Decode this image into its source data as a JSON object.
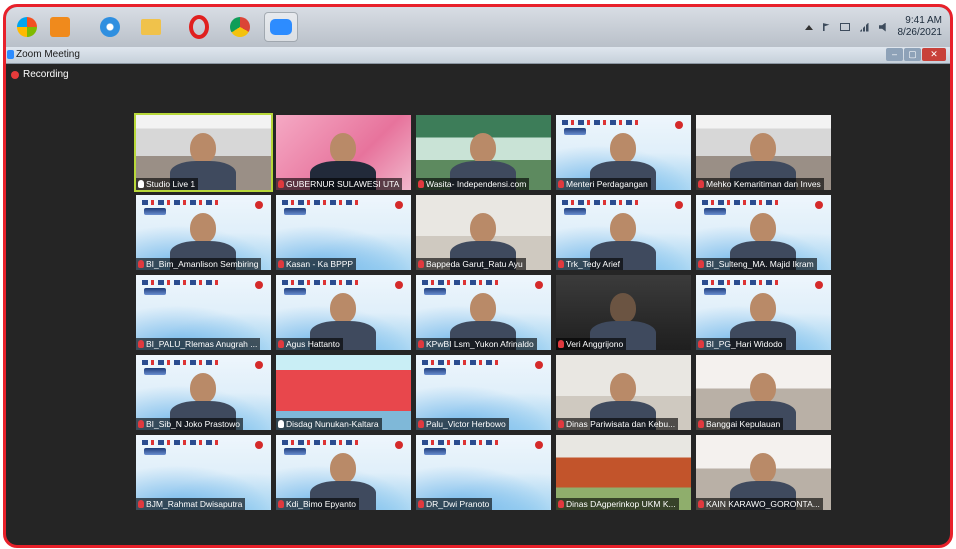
{
  "taskbar": {
    "icons": [
      {
        "name": "windows-start-icon",
        "color": "#1a73d9"
      },
      {
        "name": "media-player-icon",
        "color": "#f08a1c"
      },
      {
        "name": "internet-explorer-icon",
        "color": "#2f8fe0"
      },
      {
        "name": "file-explorer-icon",
        "color": "#f0c24b"
      },
      {
        "name": "opera-browser-icon",
        "color": "#e0201f"
      },
      {
        "name": "chrome-browser-icon",
        "color": "#2da84f"
      },
      {
        "name": "zoom-app-icon",
        "color": "#2d8cff"
      }
    ],
    "clock_time": "9:41 AM",
    "clock_date": "8/26/2021"
  },
  "window": {
    "title": "Zoom Meeting",
    "recording_label": "Recording",
    "accent": "#e8202a"
  },
  "participants": [
    {
      "name": "Studio Live 1",
      "scene": "studio",
      "muted": false,
      "active_speaker": true
    },
    {
      "name": "GUBERNUR SULAWESI UTA",
      "scene": "pink",
      "muted": true
    },
    {
      "name": "Wasita- Independensi.com",
      "scene": "banner",
      "muted": true
    },
    {
      "name": "Menteri Perdagangan",
      "scene": "slide-person",
      "muted": true
    },
    {
      "name": "Mehko Kemaritiman dan Inves",
      "scene": "studio",
      "muted": true
    },
    {
      "name": "BI_Bim_Amanlison Sembiring",
      "scene": "slide-person",
      "muted": true
    },
    {
      "name": "Kasan - Ka BPPP",
      "scene": "slide",
      "muted": true
    },
    {
      "name": "Bappeda Garut_Ratu Ayu",
      "scene": "room",
      "muted": true
    },
    {
      "name": "Trk_Tedy Arief",
      "scene": "slide-person",
      "muted": true
    },
    {
      "name": "BI_Sulteng_MA. Majid Ikram",
      "scene": "slide-person",
      "muted": true
    },
    {
      "name": "BI_PALU_Rlemas Anugrah ...",
      "scene": "slide",
      "muted": true
    },
    {
      "name": "Agus Hattanto",
      "scene": "slide-person",
      "muted": true
    },
    {
      "name": "KPwBI Lsm_Yukon Afrinaldo",
      "scene": "slide-person",
      "muted": true
    },
    {
      "name": "Veri  Anggrijono",
      "scene": "dark",
      "muted": true
    },
    {
      "name": "BI_PG_Hari Widodo",
      "scene": "slide-person",
      "muted": true
    },
    {
      "name": "BI_Sib_N Joko Prastowo",
      "scene": "slide-person",
      "muted": true
    },
    {
      "name": "Disdag Nunukan-Kaltara",
      "scene": "poster",
      "muted": false
    },
    {
      "name": "Palu_Victor Herbowo",
      "scene": "slide",
      "muted": true
    },
    {
      "name": "Dinas Pariwisata dan Kebu...",
      "scene": "room",
      "muted": true
    },
    {
      "name": "Banggai Kepulauan",
      "scene": "meeting",
      "muted": true
    },
    {
      "name": "BJM_Rahmat Dwisaputra",
      "scene": "slide",
      "muted": true
    },
    {
      "name": "Kdi_Bimo Epyanto",
      "scene": "slide-person",
      "muted": true
    },
    {
      "name": "DR_Dwi Pranoto",
      "scene": "slide",
      "muted": true
    },
    {
      "name": "Dinas DAgperinkop UKM K...",
      "scene": "building",
      "muted": true
    },
    {
      "name": "KAIN KARAWO_GORONTA...",
      "scene": "meeting",
      "muted": true
    }
  ]
}
